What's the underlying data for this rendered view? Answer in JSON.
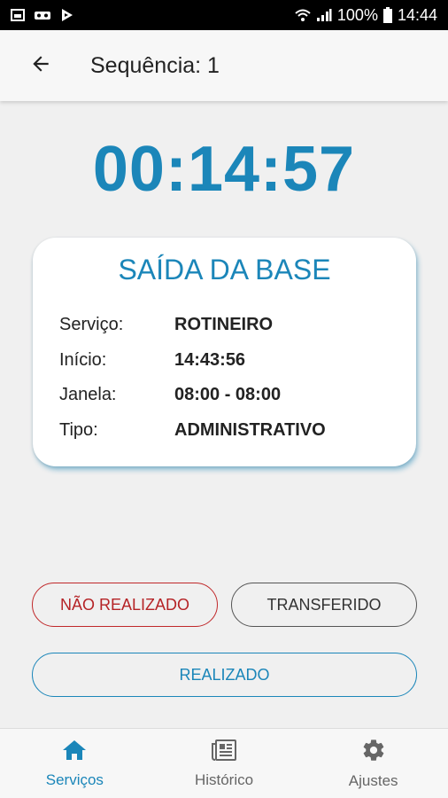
{
  "status_bar": {
    "battery": "100%",
    "time": "14:44"
  },
  "app_bar": {
    "title": "Sequência: 1"
  },
  "timer": "00:14:57",
  "card": {
    "title": "SAÍDA DA BASE",
    "rows": [
      {
        "label": "Serviço:",
        "value": "ROTINEIRO"
      },
      {
        "label": "Início:",
        "value": "14:43:56"
      },
      {
        "label": "Janela:",
        "value": "08:00 - 08:00"
      },
      {
        "label": "Tipo:",
        "value": "ADMINISTRATIVO"
      }
    ]
  },
  "buttons": {
    "nao_realizado": "NÃO REALIZADO",
    "transferido": "TRANSFERIDO",
    "realizado": "REALIZADO"
  },
  "bottom_nav": {
    "items": [
      {
        "label": "Serviços",
        "icon": "home-icon",
        "active": true
      },
      {
        "label": "Histórico",
        "icon": "newspaper-icon",
        "active": false
      },
      {
        "label": "Ajustes",
        "icon": "gear-icon",
        "active": false
      }
    ]
  },
  "colors": {
    "accent": "#1b86b9",
    "danger": "#b52326"
  }
}
